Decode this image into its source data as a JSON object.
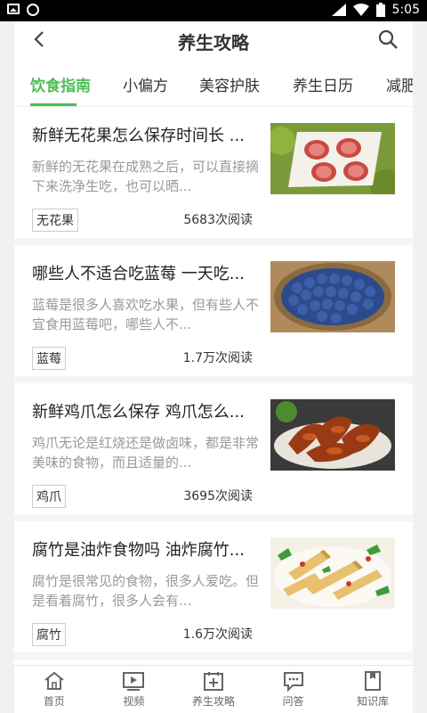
{
  "status_bar": {
    "time": "5:05"
  },
  "header": {
    "title": "养生攻略"
  },
  "tabs": [
    {
      "label": "饮食指南"
    },
    {
      "label": "小偏方"
    },
    {
      "label": "美容护肤"
    },
    {
      "label": "养生日历"
    },
    {
      "label": "减肥"
    }
  ],
  "articles": [
    {
      "title": "新鲜无花果怎么保存时间长 ...",
      "desc": "新鲜的无花果在成熟之后，可以直接摘下来洗净生吃，也可以晒...",
      "tag": "无花果",
      "views": "5683次阅读",
      "image": "figs"
    },
    {
      "title": "哪些人不适合吃蓝莓 一天吃...",
      "desc": "蓝莓是很多人喜欢吃水果，但有些人不宜食用蓝莓吧，哪些人不...",
      "tag": "蓝莓",
      "views": "1.7万次阅读",
      "image": "blueberries"
    },
    {
      "title": "新鲜鸡爪怎么保存 鸡爪怎么...",
      "desc": "鸡爪无论是红烧还是做卤味，都是非常美味的食物，而且适量的...",
      "tag": "鸡爪",
      "views": "3695次阅读",
      "image": "chicken-feet"
    },
    {
      "title": "腐竹是油炸食物吗 油炸腐竹...",
      "desc": "腐竹是很常见的食物，很多人爱吃。但是看着腐竹，很多人会有...",
      "tag": "腐竹",
      "views": "1.6万次阅读",
      "image": "tofu-skin"
    }
  ],
  "bottom_nav": [
    {
      "label": "首页",
      "icon": "home-icon"
    },
    {
      "label": "视频",
      "icon": "video-icon"
    },
    {
      "label": "养生攻略",
      "icon": "guide-icon"
    },
    {
      "label": "问答",
      "icon": "qa-icon"
    },
    {
      "label": "知识库",
      "icon": "knowledge-icon"
    }
  ],
  "colors": {
    "accent": "#4bbf53"
  }
}
